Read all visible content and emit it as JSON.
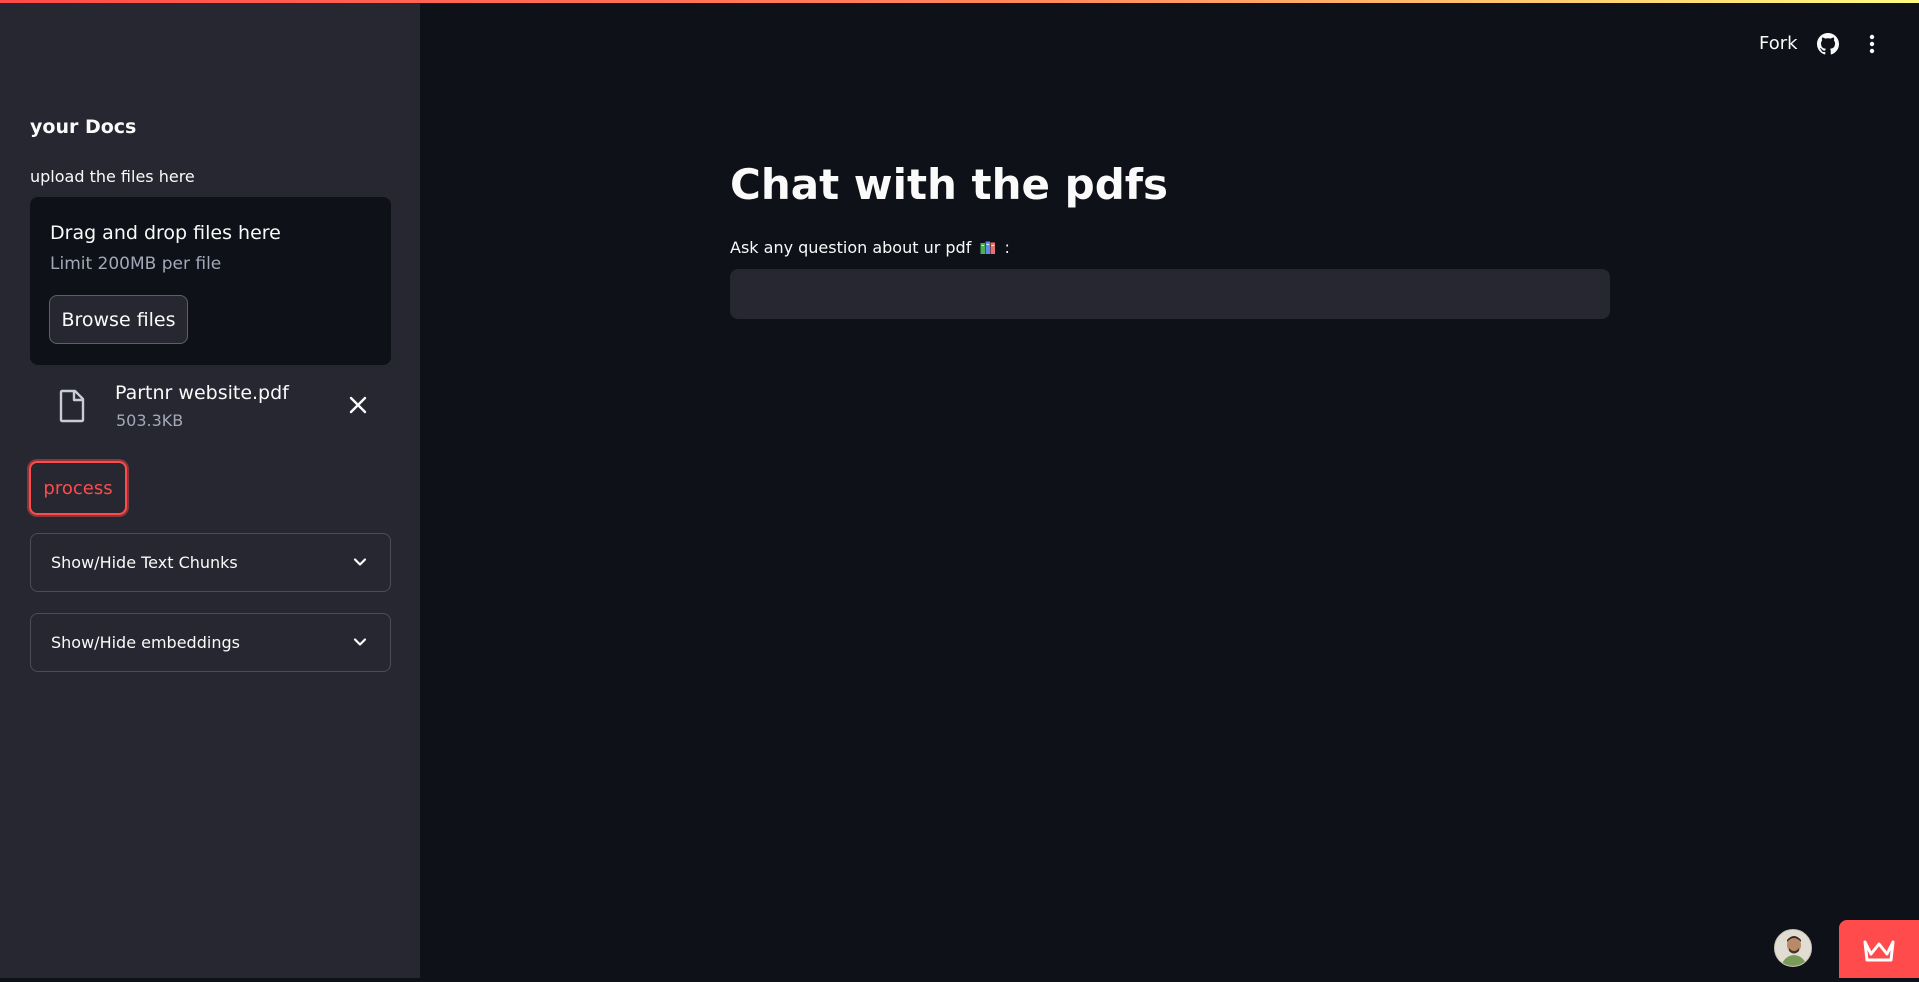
{
  "header": {
    "fork_label": "Fork",
    "github_icon": "github-icon",
    "menu_icon": "vertical-dots-icon",
    "gradient_colors": [
      "#ff4b4b",
      "#ff8a5c",
      "#fffd80"
    ]
  },
  "sidebar": {
    "title": "your Docs",
    "upload_label": "upload the files here",
    "dropzone": {
      "title": "Drag and drop files here",
      "subtitle": "Limit 200MB per file",
      "browse_label": "Browse files"
    },
    "file": {
      "name": "Partnr website.pdf",
      "size": "503.3KB",
      "icon": "file-icon",
      "remove_icon": "close-icon"
    },
    "process_label": "process",
    "expanders": [
      {
        "label": "Show/Hide Text Chunks",
        "icon": "chevron-down-icon"
      },
      {
        "label": "Show/Hide embeddings",
        "icon": "chevron-down-icon"
      }
    ]
  },
  "main": {
    "title": "Chat with the pdfs",
    "question_label_before": "Ask any question about ur pdf",
    "question_label_icon": "books-icon",
    "question_label_after": ":",
    "question_value": "",
    "question_placeholder": ""
  },
  "footer": {
    "avatar_icon": "user-avatar-icon",
    "badge_icon": "crown-icon"
  },
  "colors": {
    "sidebar_bg": "#262730",
    "main_bg": "#0e1117",
    "accent": "#ff4b4b",
    "text": "#fafafa",
    "muted": "#a3a8b8"
  }
}
